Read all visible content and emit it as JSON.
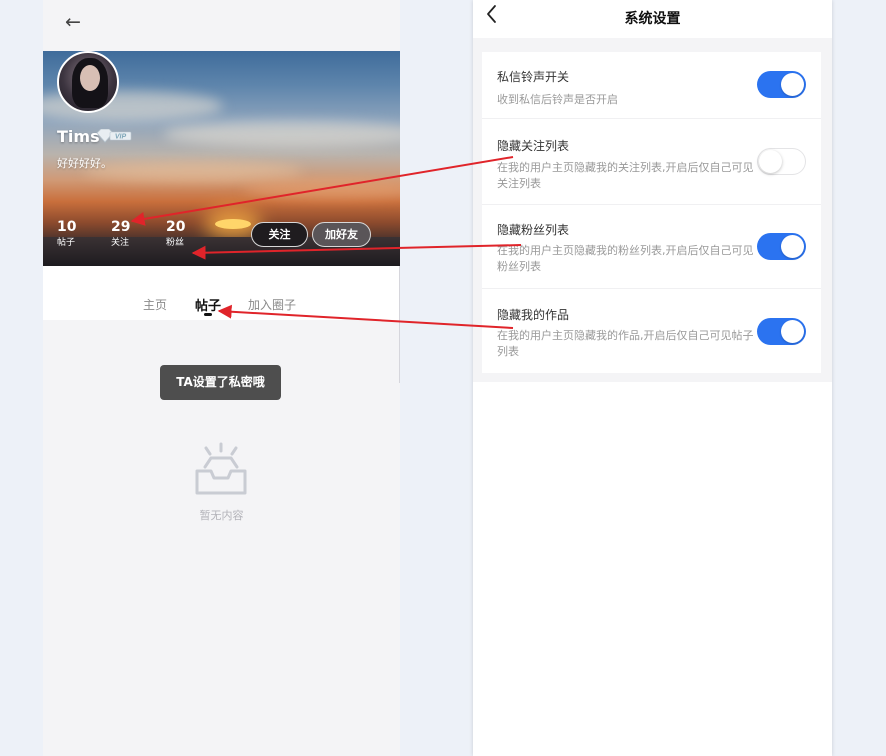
{
  "left_phone": {
    "profile": {
      "username": "Tims",
      "vip_label": "VIP",
      "bio": "好好好好。",
      "stats": [
        {
          "value": "10",
          "label": "帖子"
        },
        {
          "value": "29",
          "label": "关注"
        },
        {
          "value": "20",
          "label": "粉丝"
        }
      ],
      "follow_label": "关注",
      "add_friend_label": "加好友"
    },
    "tabs": [
      {
        "label": "主页",
        "active": false
      },
      {
        "label": "帖子",
        "active": true
      },
      {
        "label": "加入圈子",
        "active": false
      }
    ],
    "toast": "TA设置了私密哦",
    "empty_text": "暂无内容"
  },
  "right_phone": {
    "title": "系统设置",
    "settings": [
      {
        "title": "私信铃声开关",
        "desc": "收到私信后铃声是否开启",
        "enabled": true
      },
      {
        "title": "隐藏关注列表",
        "desc": "在我的用户主页隐藏我的关注列表,开启后仅自己可见关注列表",
        "enabled": false
      },
      {
        "title": "隐藏粉丝列表",
        "desc": "在我的用户主页隐藏我的粉丝列表,开启后仅自己可见粉丝列表",
        "enabled": true
      },
      {
        "title": "隐藏我的作品",
        "desc": "在我的用户主页隐藏我的作品,开启后仅自己可见帖子列表",
        "enabled": true
      }
    ]
  },
  "colors": {
    "toggle_on": "#2b73f0",
    "annotation_arrow": "#e0242a",
    "toast_bg": "#4e4e4e"
  },
  "icons": [
    "back-arrow-icon",
    "chevron-left-icon",
    "vip-diamond-icon",
    "empty-inbox-icon"
  ]
}
